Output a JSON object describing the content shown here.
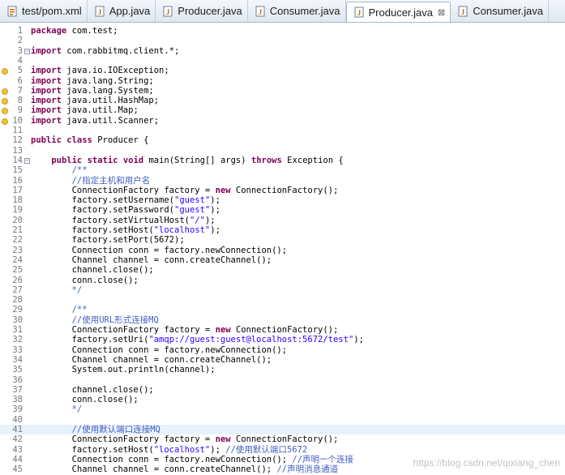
{
  "tabs": [
    {
      "label": "test/pom.xml",
      "icon": "xml-file-icon",
      "active": false
    },
    {
      "label": "App.java",
      "icon": "java-file-icon",
      "active": false
    },
    {
      "label": "Producer.java",
      "icon": "java-file-icon",
      "active": false
    },
    {
      "label": "Consumer.java",
      "icon": "java-file-icon",
      "active": false
    },
    {
      "label": "Producer.java",
      "icon": "java-file-icon",
      "active": true,
      "close": "⊠"
    },
    {
      "label": "Consumer.java",
      "icon": "java-file-icon",
      "active": false
    }
  ],
  "watermark": "https://blog.csdn.net/qixiang_chen",
  "code_lines": [
    {
      "n": "1",
      "text": "package com.test;"
    },
    {
      "n": "2",
      "text": ""
    },
    {
      "n": "3",
      "text": "import com.rabbitmq.client.*;"
    },
    {
      "n": "4",
      "text": ""
    },
    {
      "n": "5",
      "text": "import java.io.IOException;"
    },
    {
      "n": "6",
      "text": "import java.lang.String;"
    },
    {
      "n": "7",
      "text": "import java.lang.System;"
    },
    {
      "n": "8",
      "text": "import java.util.HashMap;"
    },
    {
      "n": "9",
      "text": "import java.util.Map;"
    },
    {
      "n": "10",
      "text": "import java.util.Scanner;"
    },
    {
      "n": "11",
      "text": ""
    },
    {
      "n": "12",
      "text": "public class Producer {"
    },
    {
      "n": "13",
      "text": ""
    },
    {
      "n": "14",
      "text": "    public static void main(String[] args) throws Exception {"
    },
    {
      "n": "15",
      "text": "        /**"
    },
    {
      "n": "16",
      "text": "        //指定主机和用户名"
    },
    {
      "n": "17",
      "text": "        ConnectionFactory factory = new ConnectionFactory();"
    },
    {
      "n": "18",
      "text": "        factory.setUsername(\"guest\");"
    },
    {
      "n": "19",
      "text": "        factory.setPassword(\"guest\");"
    },
    {
      "n": "20",
      "text": "        factory.setVirtualHost(\"/\");"
    },
    {
      "n": "21",
      "text": "        factory.setHost(\"localhost\");"
    },
    {
      "n": "22",
      "text": "        factory.setPort(5672);"
    },
    {
      "n": "23",
      "text": "        Connection conn = factory.newConnection();"
    },
    {
      "n": "24",
      "text": "        Channel channel = conn.createChannel();"
    },
    {
      "n": "25",
      "text": "        channel.close();"
    },
    {
      "n": "26",
      "text": "        conn.close();"
    },
    {
      "n": "27",
      "text": "        */"
    },
    {
      "n": "28",
      "text": ""
    },
    {
      "n": "29",
      "text": "        /**"
    },
    {
      "n": "30",
      "text": "        //使用URL形式连接MQ"
    },
    {
      "n": "31",
      "text": "        ConnectionFactory factory = new ConnectionFactory();"
    },
    {
      "n": "32",
      "text": "        factory.setUri(\"amqp://guest:guest@localhost:5672/test\");"
    },
    {
      "n": "33",
      "text": "        Connection conn = factory.newConnection();"
    },
    {
      "n": "34",
      "text": "        Channel channel = conn.createChannel();"
    },
    {
      "n": "35",
      "text": "        System.out.println(channel);"
    },
    {
      "n": "36",
      "text": ""
    },
    {
      "n": "37",
      "text": "        channel.close();"
    },
    {
      "n": "38",
      "text": "        conn.close();"
    },
    {
      "n": "39",
      "text": "        */"
    },
    {
      "n": "40",
      "text": ""
    },
    {
      "n": "41",
      "text": "        //使用默认端口连接MQ"
    },
    {
      "n": "42",
      "text": "        ConnectionFactory factory = new ConnectionFactory();"
    },
    {
      "n": "43",
      "text": "        factory.setHost(\"localhost\"); //使用默认端口5672"
    },
    {
      "n": "44",
      "text": "        Connection conn = factory.newConnection(); //声明一个连接"
    },
    {
      "n": "45",
      "text": "        Channel channel = conn.createChannel(); //声明消息通道"
    }
  ],
  "colors": {
    "keyword": "#7f0055",
    "comment": "#3f5fbf",
    "string": "#2a00ff",
    "line_number": "#787878",
    "current_line": "#e8f2fe"
  }
}
